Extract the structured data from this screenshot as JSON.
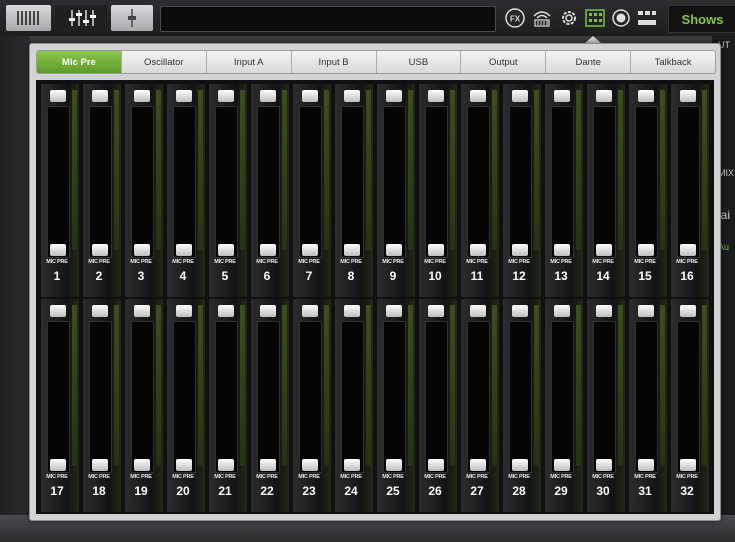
{
  "toolbar": {
    "shows_label": "Shows",
    "fx_label": "FX"
  },
  "background": {
    "right_labels": [
      "UT",
      "MIX",
      "lai",
      "Au"
    ]
  },
  "tabs": [
    {
      "label": "Mic Pre",
      "active": true
    },
    {
      "label": "Oscillator",
      "active": false
    },
    {
      "label": "Input A",
      "active": false
    },
    {
      "label": "Input B",
      "active": false
    },
    {
      "label": "USB",
      "active": false
    },
    {
      "label": "Output",
      "active": false
    },
    {
      "label": "Dante",
      "active": false
    },
    {
      "label": "Talkback",
      "active": false
    }
  ],
  "channels": [
    {
      "label": "MIC PRE",
      "number": "1"
    },
    {
      "label": "MIC PRE",
      "number": "2"
    },
    {
      "label": "MIC PRE",
      "number": "3"
    },
    {
      "label": "MIC PRE",
      "number": "4"
    },
    {
      "label": "MIC PRE",
      "number": "5"
    },
    {
      "label": "MIC PRE",
      "number": "6"
    },
    {
      "label": "MIC PRE",
      "number": "7"
    },
    {
      "label": "MIC PRE",
      "number": "8"
    },
    {
      "label": "MIC PRE",
      "number": "9"
    },
    {
      "label": "MIC PRE",
      "number": "10"
    },
    {
      "label": "MIC PRE",
      "number": "11"
    },
    {
      "label": "MIC PRE",
      "number": "12"
    },
    {
      "label": "MIC PRE",
      "number": "13"
    },
    {
      "label": "MIC PRE",
      "number": "14"
    },
    {
      "label": "MIC PRE",
      "number": "15"
    },
    {
      "label": "MIC PRE",
      "number": "16"
    },
    {
      "label": "MIC PRE",
      "number": "17"
    },
    {
      "label": "MIC PRE",
      "number": "18"
    },
    {
      "label": "MIC PRE",
      "number": "19"
    },
    {
      "label": "MIC PRE",
      "number": "20"
    },
    {
      "label": "MIC PRE",
      "number": "21"
    },
    {
      "label": "MIC PRE",
      "number": "22"
    },
    {
      "label": "MIC PRE",
      "number": "23"
    },
    {
      "label": "MIC PRE",
      "number": "24"
    },
    {
      "label": "MIC PRE",
      "number": "25"
    },
    {
      "label": "MIC PRE",
      "number": "26"
    },
    {
      "label": "MIC PRE",
      "number": "27"
    },
    {
      "label": "MIC PRE",
      "number": "28"
    },
    {
      "label": "MIC PRE",
      "number": "29"
    },
    {
      "label": "MIC PRE",
      "number": "30"
    },
    {
      "label": "MIC PRE",
      "number": "31"
    },
    {
      "label": "MIC PRE",
      "number": "32"
    }
  ],
  "colors": {
    "accent_green": "#6fae35",
    "shows_green": "#87c540"
  },
  "icons": [
    "mixer-grid-icon",
    "eq-sliders-icon",
    "single-fader-icon",
    "fx-icon",
    "wireless-icon",
    "gear-icon",
    "patch-icon",
    "record-icon",
    "meters-icon"
  ]
}
